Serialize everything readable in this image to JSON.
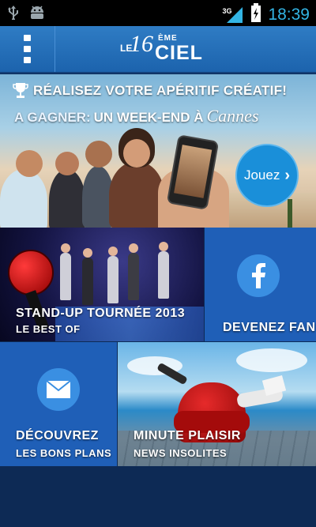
{
  "status_bar": {
    "icons": [
      "usb-icon",
      "android-icon",
      "signal-3g-icon",
      "battery-icon"
    ],
    "network": "3G",
    "time": "18:39"
  },
  "header": {
    "logo": {
      "le": "LE",
      "number": "16",
      "eme": "ÈME",
      "ciel": "CIEL"
    },
    "menu_icon": "overflow-menu-icon"
  },
  "hero": {
    "title": "RÉALISEZ VOTRE APÉRITIF CRÉATIF!",
    "prize_prefix": "A GAGNER:",
    "prize_main": "UN WEEK-END À",
    "prize_city": "Cannes",
    "cta_label": "Jouez",
    "icon": "trophy-icon"
  },
  "tiles": {
    "standup": {
      "line1": "STAND-UP TOURNÉE 2013",
      "line2": "LE BEST OF"
    },
    "fan": {
      "label": "DEVENEZ FAN",
      "icon": "facebook-icon"
    },
    "bons_plans": {
      "line1": "DÉCOUVREZ",
      "line2": "LES BONS PLANS",
      "icon": "envelope-icon"
    },
    "minute": {
      "line1": "MINUTE PLAISIR",
      "line2": "NEWS INSOLITES"
    }
  },
  "colors": {
    "header": "#1c63ad",
    "tile_blue": "#1f5fb7",
    "accent_circle": "#3a8fe2",
    "background": "#0d2a55",
    "status_text": "#33b5e5"
  }
}
